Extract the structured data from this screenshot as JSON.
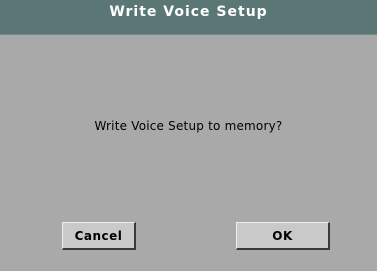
{
  "dialog": {
    "title": "Write Voice Setup",
    "message": "Write Voice Setup to memory?",
    "buttons": {
      "cancel_label": "Cancel",
      "ok_label": "OK"
    }
  },
  "colors": {
    "titlebar": "#5a7775",
    "background": "#a9a9a9",
    "button_face": "#c9c9c9"
  }
}
